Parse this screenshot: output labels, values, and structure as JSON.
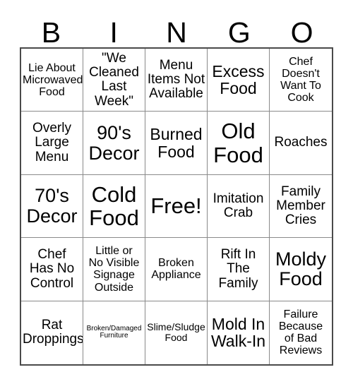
{
  "card": {
    "header_letters": [
      "B",
      "I",
      "N",
      "G",
      "O"
    ],
    "free_space_label": "Free!",
    "colors": {
      "background": "#ffffff",
      "text": "#000000",
      "inner_border": "#8a8a8a",
      "outer_border": "#4a4a4a"
    },
    "grid": {
      "columns": 5,
      "rows": 5,
      "cells": [
        {
          "text": "Lie About\nMicrowaved\nFood",
          "size": "sm"
        },
        {
          "text": "\"We\nCleaned\nLast\nWeek\"",
          "size": "md"
        },
        {
          "text": "Menu\nItems Not\nAvailable",
          "size": "md"
        },
        {
          "text": "Excess\nFood",
          "size": "lg"
        },
        {
          "text": "Chef\nDoesn't\nWant To\nCook",
          "size": "sm"
        },
        {
          "text": "Overly\nLarge\nMenu",
          "size": "md"
        },
        {
          "text": "90's\nDecor",
          "size": "xl"
        },
        {
          "text": "Burned\nFood",
          "size": "lg"
        },
        {
          "text": "Old\nFood",
          "size": "xxl"
        },
        {
          "text": "Roaches",
          "size": "md"
        },
        {
          "text": "70's\nDecor",
          "size": "xl"
        },
        {
          "text": "Cold\nFood",
          "size": "xxl"
        },
        {
          "text": "Free!",
          "size": "xxl"
        },
        {
          "text": "Imitation\nCrab",
          "size": "md"
        },
        {
          "text": "Family\nMember\nCries",
          "size": "md"
        },
        {
          "text": "Chef\nHas No\nControl",
          "size": "md"
        },
        {
          "text": "Little or\nNo Visible\nSignage\nOutside",
          "size": "sm"
        },
        {
          "text": "Broken\nAppliance",
          "size": "sm"
        },
        {
          "text": "Rift In\nThe\nFamily",
          "size": "md"
        },
        {
          "text": "Moldy\nFood",
          "size": "xl"
        },
        {
          "text": "Rat\nDroppings",
          "size": "md"
        },
        {
          "text": "Broken/Damaged\nFurniture",
          "size": "xxs"
        },
        {
          "text": "Slime/Sludge\nFood",
          "size": "xs"
        },
        {
          "text": "Mold In\nWalk-In",
          "size": "lg"
        },
        {
          "text": "Failure\nBecause\nof Bad\nReviews",
          "size": "sm"
        }
      ]
    }
  }
}
